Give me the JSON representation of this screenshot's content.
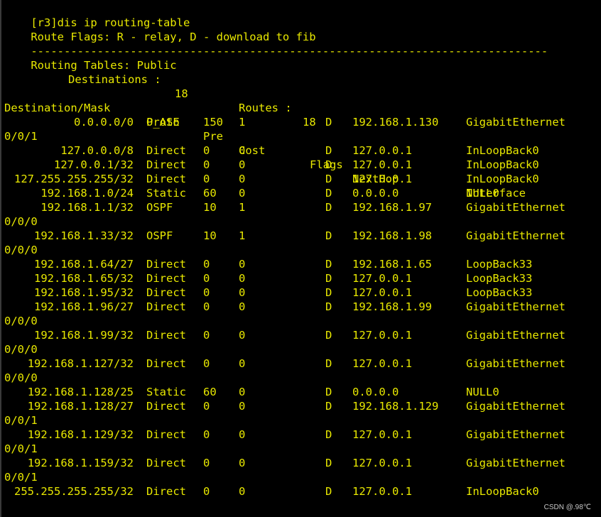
{
  "prompt": "[r3]dis ip routing-table",
  "flags_line": "Route Flags: R - relay, D - download to fib",
  "separator": "------------------------------------------------------------------------------",
  "table_title": "Routing Tables: Public",
  "summary": {
    "destinations_label": "Destinations :",
    "destinations": "18",
    "routes_label": "Routes :",
    "routes": "18"
  },
  "columns": {
    "destination": "Destination/Mask",
    "proto": "Proto",
    "pre": "Pre",
    "cost": "Cost",
    "flags": "Flags",
    "nexthop": "NextHop",
    "interface": "Interface"
  },
  "routes": [
    {
      "dest": "0.0.0.0/0",
      "proto": "O_ASE",
      "pre": "150",
      "cost": "1",
      "flags": "D",
      "nexthop": "192.168.1.130",
      "iface": "GigabitEthernet",
      "iface_cont": "0/0/1"
    },
    {
      "dest": "127.0.0.0/8",
      "proto": "Direct",
      "pre": "0",
      "cost": "0",
      "flags": "D",
      "nexthop": "127.0.0.1",
      "iface": "InLoopBack0",
      "iface_cont": ""
    },
    {
      "dest": "127.0.0.1/32",
      "proto": "Direct",
      "pre": "0",
      "cost": "0",
      "flags": "D",
      "nexthop": "127.0.0.1",
      "iface": "InLoopBack0",
      "iface_cont": ""
    },
    {
      "dest": "127.255.255.255/32",
      "proto": "Direct",
      "pre": "0",
      "cost": "0",
      "flags": "D",
      "nexthop": "127.0.0.1",
      "iface": "InLoopBack0",
      "iface_cont": ""
    },
    {
      "dest": "192.168.1.0/24",
      "proto": "Static",
      "pre": "60",
      "cost": "0",
      "flags": "D",
      "nexthop": "0.0.0.0",
      "iface": "NULL0",
      "iface_cont": ""
    },
    {
      "dest": "192.168.1.1/32",
      "proto": "OSPF",
      "pre": "10",
      "cost": "1",
      "flags": "D",
      "nexthop": "192.168.1.97",
      "iface": "GigabitEthernet",
      "iface_cont": "0/0/0"
    },
    {
      "dest": "192.168.1.33/32",
      "proto": "OSPF",
      "pre": "10",
      "cost": "1",
      "flags": "D",
      "nexthop": "192.168.1.98",
      "iface": "GigabitEthernet",
      "iface_cont": "0/0/0"
    },
    {
      "dest": "192.168.1.64/27",
      "proto": "Direct",
      "pre": "0",
      "cost": "0",
      "flags": "D",
      "nexthop": "192.168.1.65",
      "iface": "LoopBack33",
      "iface_cont": ""
    },
    {
      "dest": "192.168.1.65/32",
      "proto": "Direct",
      "pre": "0",
      "cost": "0",
      "flags": "D",
      "nexthop": "127.0.0.1",
      "iface": "LoopBack33",
      "iface_cont": ""
    },
    {
      "dest": "192.168.1.95/32",
      "proto": "Direct",
      "pre": "0",
      "cost": "0",
      "flags": "D",
      "nexthop": "127.0.0.1",
      "iface": "LoopBack33",
      "iface_cont": ""
    },
    {
      "dest": "192.168.1.96/27",
      "proto": "Direct",
      "pre": "0",
      "cost": "0",
      "flags": "D",
      "nexthop": "192.168.1.99",
      "iface": "GigabitEthernet",
      "iface_cont": "0/0/0"
    },
    {
      "dest": "192.168.1.99/32",
      "proto": "Direct",
      "pre": "0",
      "cost": "0",
      "flags": "D",
      "nexthop": "127.0.0.1",
      "iface": "GigabitEthernet",
      "iface_cont": "0/0/0"
    },
    {
      "dest": "192.168.1.127/32",
      "proto": "Direct",
      "pre": "0",
      "cost": "0",
      "flags": "D",
      "nexthop": "127.0.0.1",
      "iface": "GigabitEthernet",
      "iface_cont": "0/0/0"
    },
    {
      "dest": "192.168.1.128/25",
      "proto": "Static",
      "pre": "60",
      "cost": "0",
      "flags": "D",
      "nexthop": "0.0.0.0",
      "iface": "NULL0",
      "iface_cont": ""
    },
    {
      "dest": "192.168.1.128/27",
      "proto": "Direct",
      "pre": "0",
      "cost": "0",
      "flags": "D",
      "nexthop": "192.168.1.129",
      "iface": "GigabitEthernet",
      "iface_cont": "0/0/1"
    },
    {
      "dest": "192.168.1.129/32",
      "proto": "Direct",
      "pre": "0",
      "cost": "0",
      "flags": "D",
      "nexthop": "127.0.0.1",
      "iface": "GigabitEthernet",
      "iface_cont": "0/0/1"
    },
    {
      "dest": "192.168.1.159/32",
      "proto": "Direct",
      "pre": "0",
      "cost": "0",
      "flags": "D",
      "nexthop": "127.0.0.1",
      "iface": "GigabitEthernet",
      "iface_cont": "0/0/1"
    },
    {
      "dest": "255.255.255.255/32",
      "proto": "Direct",
      "pre": "0",
      "cost": "0",
      "flags": "D",
      "nexthop": "127.0.0.1",
      "iface": "InLoopBack0",
      "iface_cont": ""
    }
  ],
  "watermark": "CSDN @.98℃",
  "colors": {
    "background": "#000000",
    "text": "#e8e800"
  }
}
